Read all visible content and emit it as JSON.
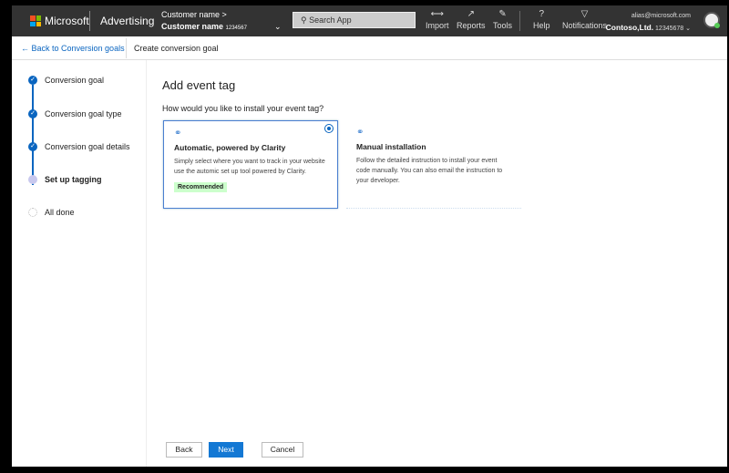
{
  "header": {
    "brand": "Microsoft",
    "product": "Advertising",
    "customer_top": "Customer name",
    "customer_name": "Customer name",
    "customer_id": "1234567",
    "search_placeholder": "Search App",
    "nav": [
      {
        "label": "Import",
        "icon": "import-icon"
      },
      {
        "label": "Reports",
        "icon": "reports-icon"
      },
      {
        "label": "Tools",
        "icon": "tools-icon"
      },
      {
        "label": "Help",
        "icon": "help-icon"
      },
      {
        "label": "Notifications",
        "icon": "bell-icon"
      }
    ],
    "account_email": "alias@microsoft.com",
    "account_name": "Contoso,Ltd.",
    "account_id": "12345678"
  },
  "subheader": {
    "back_label": "Back to Conversion goals",
    "title": "Create conversion goal"
  },
  "steps": [
    {
      "label": "Conversion goal",
      "state": "done"
    },
    {
      "label": "Conversion goal type",
      "state": "done"
    },
    {
      "label": "Conversion goal details",
      "state": "done"
    },
    {
      "label": "Set up tagging",
      "state": "current"
    },
    {
      "label": "All done",
      "state": "pending"
    }
  ],
  "main": {
    "title": "Add event tag",
    "question": "How would you like to install your event tag?",
    "options": [
      {
        "title": "Automatic, powered by Clarity",
        "description": "Simply select where you want to track in your website use the automic set up tool powered by Clarity.",
        "badge": "Recommended",
        "selected": true
      },
      {
        "title": "Manual installation",
        "description": "Follow the detailed instruction to install your event code manually. You can also email the instruction to your developer.",
        "selected": false
      }
    ]
  },
  "footer": {
    "back": "Back",
    "next": "Next",
    "cancel": "Cancel"
  },
  "colors": {
    "accent": "#1378d4",
    "header_bg": "#333333",
    "badge_bg": "#ccffcc"
  }
}
